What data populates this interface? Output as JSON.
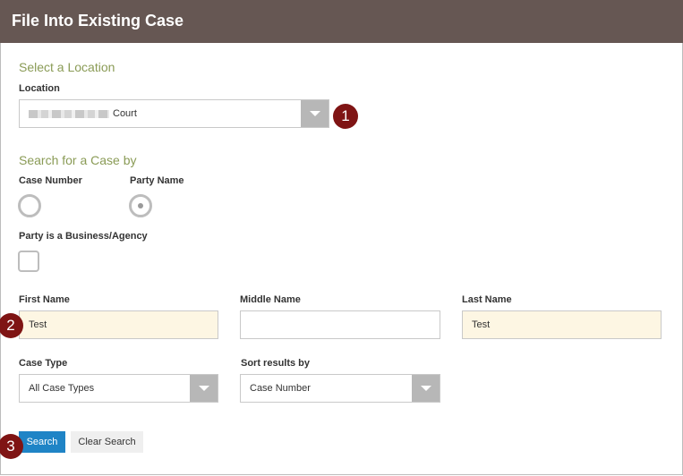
{
  "header": {
    "title": "File Into Existing Case"
  },
  "location": {
    "section_title": "Select a Location",
    "label": "Location",
    "selected_value": "Court"
  },
  "search_by": {
    "section_title": "Search for a Case by",
    "options": [
      {
        "label": "Case Number",
        "checked": false
      },
      {
        "label": "Party Name",
        "checked": true
      }
    ]
  },
  "business": {
    "label": "Party is a Business/Agency",
    "checked": false
  },
  "name": {
    "first_label": "First Name",
    "first_value": "Test",
    "middle_label": "Middle Name",
    "middle_value": "",
    "last_label": "Last Name",
    "last_value": "Test"
  },
  "case_type": {
    "label": "Case Type",
    "selected_value": "All Case Types"
  },
  "sort": {
    "label": "Sort results by",
    "selected_value": "Case Number"
  },
  "buttons": {
    "search": "Search",
    "clear": "Clear Search"
  },
  "badges": {
    "one": "1",
    "two": "2",
    "three": "3"
  },
  "colors": {
    "header": "#665753",
    "accent_title": "#8a9b56",
    "badge": "#7f1414",
    "primary_button": "#1f84c6",
    "filled_input": "#fdf6e3"
  }
}
